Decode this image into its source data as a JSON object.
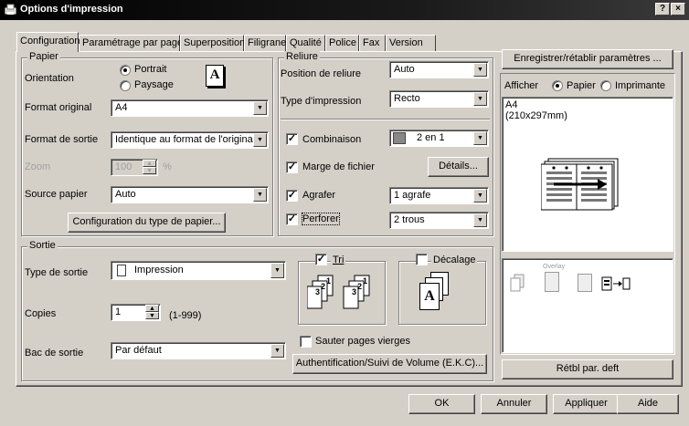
{
  "window": {
    "title": "Options d'impression",
    "help_label": "?",
    "close_label": "×"
  },
  "tabs": [
    "Configuration",
    "Paramétrage par page",
    "Superposition",
    "Filigrane",
    "Qualité",
    "Police",
    "Fax",
    "Version"
  ],
  "papier": {
    "group_title": "Papier",
    "orientation_label": "Orientation",
    "portrait_label": "Portrait",
    "paysage_label": "Paysage",
    "orientation_icon_letter": "A",
    "format_original_label": "Format original",
    "format_original_value": "A4",
    "format_sortie_label": "Format de sortie",
    "format_sortie_value": "Identique au format de l'original",
    "zoom_label": "Zoom",
    "zoom_value": "100",
    "zoom_unit": "%",
    "source_label": "Source papier",
    "source_value": "Auto",
    "config_button": "Configuration du type de papier..."
  },
  "reliure": {
    "group_title": "Reliure",
    "position_label": "Position de reliure",
    "position_value": "Auto",
    "type_label": "Type d'impression",
    "type_value": "Recto",
    "combinaison_label": "Combinaison",
    "combinaison_value": "2 en 1",
    "marge_label": "Marge de fichier",
    "details_button": "Détails...",
    "agrafer_label": "Agrafer",
    "agrafer_value": "1 agrafe",
    "perforer_label": "Perforer",
    "perforer_value": "2 trous"
  },
  "sortie": {
    "group_title": "Sortie",
    "type_label": "Type de sortie",
    "type_value": "Impression",
    "copies_label": "Copies",
    "copies_value": "1",
    "copies_range": "(1-999)",
    "bac_label": "Bac de sortie",
    "bac_value": "Par défaut",
    "tri_label": "Tri",
    "decalage_label": "Décalage",
    "sauter_label": "Sauter pages vierges",
    "auth_button": "Authentification/Suivi de Volume (E.K.C)...",
    "tri_numbers": [
      "1",
      "2",
      "3",
      "1",
      "2",
      "3"
    ],
    "decalage_letter": "A"
  },
  "right_panel": {
    "save_button": "Enregistrer/rétablir paramètres ...",
    "afficher_label": "Afficher",
    "papier_radio": "Papier",
    "imprimante_radio": "Imprimante",
    "preview_line1": "A4",
    "preview_line2": "(210x297mm)",
    "overlay_label": "Overlay",
    "reset_button": "Rétbl par. deft"
  },
  "footer": {
    "ok": "OK",
    "annuler": "Annuler",
    "appliquer": "Appliquer",
    "aide": "Aide"
  }
}
